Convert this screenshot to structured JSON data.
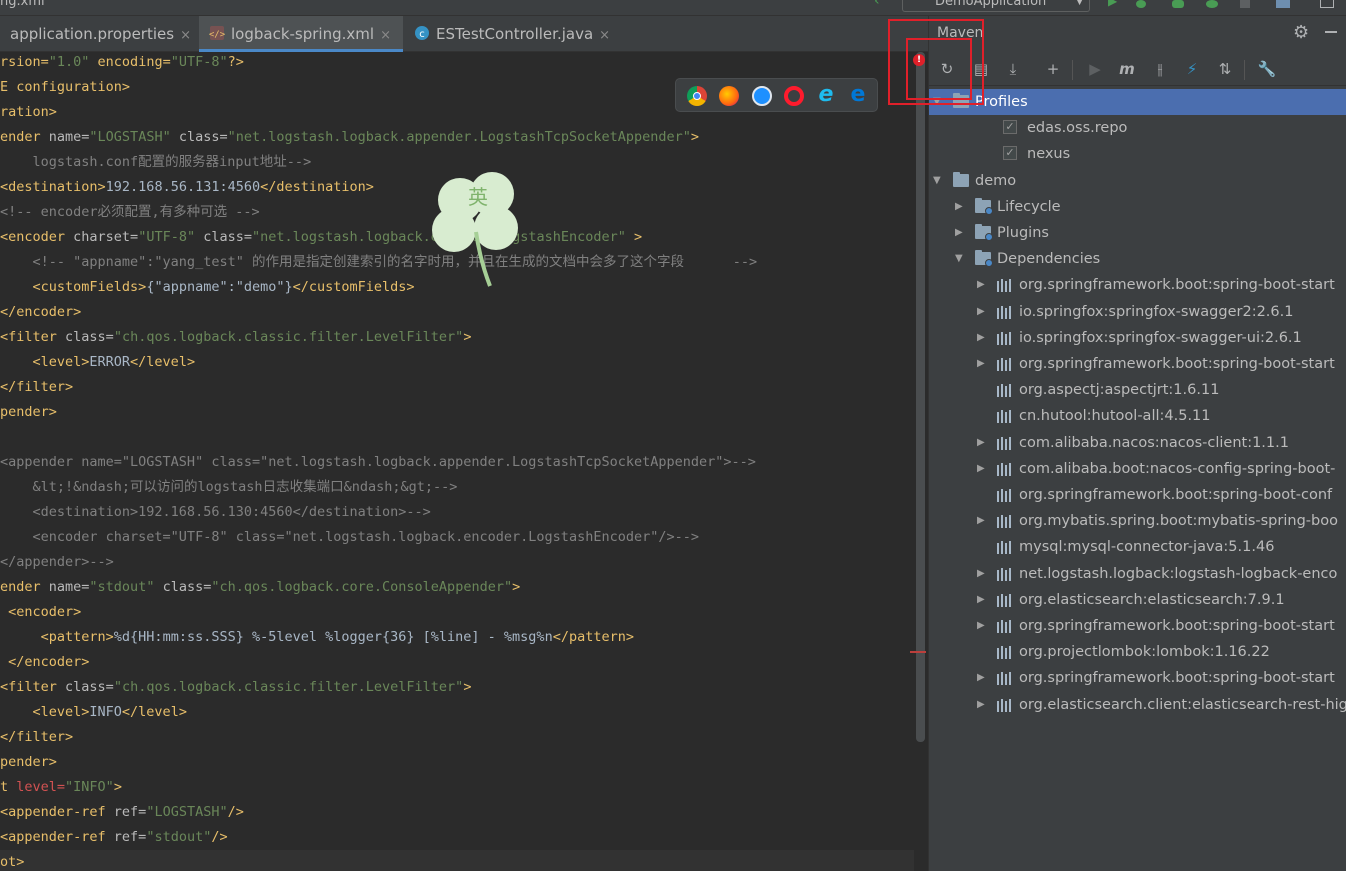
{
  "window": {
    "title": "ng.xml"
  },
  "run_config": {
    "name": "DemoApplication"
  },
  "tabs": [
    {
      "label": "application.properties",
      "close": "×"
    },
    {
      "label": "logback-spring.xml",
      "close": "×"
    },
    {
      "label": "ESTestController.java",
      "close": "×"
    }
  ],
  "browser_popup": {
    "icons": [
      "chrome-icon",
      "firefox-icon",
      "safari-icon",
      "opera-icon",
      "ie-icon",
      "edge-icon"
    ]
  },
  "watermark": {
    "glyph": "英"
  },
  "editor": {
    "lines": [
      [
        [
          "t",
          "rsion="
        ],
        [
          "v",
          "\"1.0\""
        ],
        [
          "t",
          " encoding="
        ],
        [
          "v",
          "\"UTF-8\""
        ],
        [
          "t",
          "?>"
        ]
      ],
      [
        [
          "t",
          "E configuration>"
        ]
      ],
      [
        [
          "t",
          "ration>"
        ]
      ],
      [
        [
          "t",
          "ender "
        ],
        [
          "a",
          "name="
        ],
        [
          "v",
          "\"LOGSTASH\""
        ],
        [
          "a",
          " class="
        ],
        [
          "v",
          "\"net.logstash.logback.appender.LogstashTcpSocketAppender\""
        ],
        [
          "t",
          ">"
        ]
      ],
      [
        [
          "c",
          "    logstash.conf配置的服务器input地址-->"
        ]
      ],
      [
        [
          "t",
          "<destination>"
        ],
        [
          "txt",
          "192.168.56.131:4560"
        ],
        [
          "t",
          "</destination>"
        ]
      ],
      [
        [
          "c",
          "<!-- encoder必须配置,有多种可选 -->"
        ]
      ],
      [
        [
          "t",
          "<encoder "
        ],
        [
          "a",
          "charset="
        ],
        [
          "v",
          "\"UTF-8\""
        ],
        [
          "a",
          " class="
        ],
        [
          "v",
          "\"net.logstash.logback.encoder.LogstashEncoder\""
        ],
        [
          "t",
          " >"
        ]
      ],
      [
        [
          "c",
          "    <!-- \"appname\":\"yang_test\" 的作用是指定创建索引的名字时用，并且在生成的文档中会多了这个字段      -->"
        ]
      ],
      [
        [
          "t",
          "    <customFields>"
        ],
        [
          "txt",
          "{\"appname\":\"demo\"}"
        ],
        [
          "t",
          "</customFields>"
        ]
      ],
      [
        [
          "t",
          "</encoder>"
        ]
      ],
      [
        [
          "t",
          "<filter "
        ],
        [
          "a",
          "class="
        ],
        [
          "v",
          "\"ch.qos.logback.classic.filter.LevelFilter\""
        ],
        [
          "t",
          ">"
        ]
      ],
      [
        [
          "t",
          "    <level>"
        ],
        [
          "txt",
          "ERROR"
        ],
        [
          "t",
          "</level>"
        ]
      ],
      [
        [
          "t",
          "</filter>"
        ]
      ],
      [
        [
          "t",
          "pender>"
        ]
      ],
      [
        [
          "txt",
          ""
        ]
      ],
      [
        [
          "c",
          "<appender name=\"LOGSTASH\" class=\"net.logstash.logback.appender.LogstashTcpSocketAppender\">-->"
        ]
      ],
      [
        [
          "c",
          "    &lt;!&ndash;可以访问的logstash日志收集端口&ndash;&gt;-->"
        ]
      ],
      [
        [
          "c",
          "    <destination>192.168.56.130:4560</destination>-->"
        ]
      ],
      [
        [
          "c",
          "    <encoder charset=\"UTF-8\" class=\"net.logstash.logback.encoder.LogstashEncoder\"/>-->"
        ]
      ],
      [
        [
          "c",
          "</appender>-->"
        ]
      ],
      [
        [
          "t",
          "ender "
        ],
        [
          "a",
          "name="
        ],
        [
          "v",
          "\"stdout\""
        ],
        [
          "a",
          " class="
        ],
        [
          "v",
          "\"ch.qos.logback.core.ConsoleAppender\""
        ],
        [
          "t",
          ">"
        ]
      ],
      [
        [
          "t",
          " <encoder>"
        ]
      ],
      [
        [
          "t",
          "     <pattern>"
        ],
        [
          "txt",
          "%d{HH:mm:ss.SSS} %-5level %logger{36} [%line] - %msg%n"
        ],
        [
          "t",
          "</pattern>"
        ]
      ],
      [
        [
          "t",
          " </encoder>"
        ]
      ],
      [
        [
          "t",
          "<filter "
        ],
        [
          "a",
          "class="
        ],
        [
          "v",
          "\"ch.qos.logback.classic.filter.LevelFilter\""
        ],
        [
          "t",
          ">"
        ]
      ],
      [
        [
          "t",
          "    <level>"
        ],
        [
          "txt",
          "INFO"
        ],
        [
          "t",
          "</level>"
        ]
      ],
      [
        [
          "t",
          "</filter>"
        ]
      ],
      [
        [
          "t",
          "pender>"
        ]
      ],
      [
        [
          "t",
          "t "
        ],
        [
          "red",
          "level="
        ],
        [
          "v",
          "\"INFO\""
        ],
        [
          "t",
          ">"
        ]
      ],
      [
        [
          "t",
          "<appender-ref "
        ],
        [
          "a",
          "ref="
        ],
        [
          "v",
          "\"LOGSTASH\""
        ],
        [
          "t",
          "/>"
        ]
      ],
      [
        [
          "t",
          "<appender-ref "
        ],
        [
          "a",
          "ref="
        ],
        [
          "v",
          "\"stdout\""
        ],
        [
          "t",
          "/>"
        ]
      ],
      [
        [
          "t",
          "ot>"
        ]
      ]
    ]
  },
  "maven": {
    "title": "Maven",
    "toolbar": [
      "reload-icon",
      "generate-sources-icon",
      "download-icon",
      "add-icon",
      "run-icon",
      "execute-goal-icon",
      "toggle-offline-icon",
      "skip-tests-icon",
      "show-dependencies-icon",
      "collapse-all-icon",
      "settings-wrench-icon"
    ],
    "tree": [
      {
        "label": "Profiles",
        "kind": "folder",
        "depth": 0,
        "expanded": true,
        "selected": true
      },
      {
        "label": "edas.oss.repo",
        "kind": "checkbox",
        "depth": 1,
        "checked": true
      },
      {
        "label": "nexus",
        "kind": "checkbox",
        "depth": 1,
        "checked": true
      },
      {
        "label": "demo",
        "kind": "project",
        "depth": 0,
        "expanded": true
      },
      {
        "label": "Lifecycle",
        "kind": "folder",
        "depth": 1,
        "expanded": false
      },
      {
        "label": "Plugins",
        "kind": "folder",
        "depth": 1,
        "expanded": false
      },
      {
        "label": "Dependencies",
        "kind": "folder",
        "depth": 1,
        "expanded": true
      },
      {
        "label": "org.springframework.boot:spring-boot-start",
        "kind": "dep",
        "depth": 2,
        "has_children": true
      },
      {
        "label": "io.springfox:springfox-swagger2:2.6.1",
        "kind": "dep",
        "depth": 2,
        "has_children": true
      },
      {
        "label": "io.springfox:springfox-swagger-ui:2.6.1",
        "kind": "dep",
        "depth": 2,
        "has_children": true
      },
      {
        "label": "org.springframework.boot:spring-boot-start",
        "kind": "dep",
        "depth": 2,
        "has_children": true
      },
      {
        "label": "org.aspectj:aspectjrt:1.6.11",
        "kind": "dep",
        "depth": 2,
        "has_children": false
      },
      {
        "label": "cn.hutool:hutool-all:4.5.11",
        "kind": "dep",
        "depth": 2,
        "has_children": false
      },
      {
        "label": "com.alibaba.nacos:nacos-client:1.1.1",
        "kind": "dep",
        "depth": 2,
        "has_children": true
      },
      {
        "label": "com.alibaba.boot:nacos-config-spring-boot-",
        "kind": "dep",
        "depth": 2,
        "has_children": true
      },
      {
        "label": "org.springframework.boot:spring-boot-conf",
        "kind": "dep",
        "depth": 2,
        "has_children": false
      },
      {
        "label": "org.mybatis.spring.boot:mybatis-spring-boo",
        "kind": "dep",
        "depth": 2,
        "has_children": true
      },
      {
        "label": "mysql:mysql-connector-java:5.1.46",
        "kind": "dep",
        "depth": 2,
        "has_children": false
      },
      {
        "label": "net.logstash.logback:logstash-logback-enco",
        "kind": "dep",
        "depth": 2,
        "has_children": true
      },
      {
        "label": "org.elasticsearch:elasticsearch:7.9.1",
        "kind": "dep",
        "depth": 2,
        "has_children": true
      },
      {
        "label": "org.springframework.boot:spring-boot-start",
        "kind": "dep",
        "depth": 2,
        "has_children": true
      },
      {
        "label": "org.projectlombok:lombok:1.16.22",
        "kind": "dep",
        "depth": 2,
        "has_children": false
      },
      {
        "label": "org.springframework.boot:spring-boot-start",
        "kind": "dep",
        "depth": 2,
        "has_children": true
      },
      {
        "label": "org.elasticsearch.client:elasticsearch-rest-hig",
        "kind": "dep",
        "depth": 2,
        "has_children": true
      }
    ]
  },
  "colors": {
    "accent": "#4b6eaf",
    "annotation": "#e0202a",
    "tag": "#e8bf6a",
    "string": "#6a8759",
    "comment": "#808080"
  }
}
